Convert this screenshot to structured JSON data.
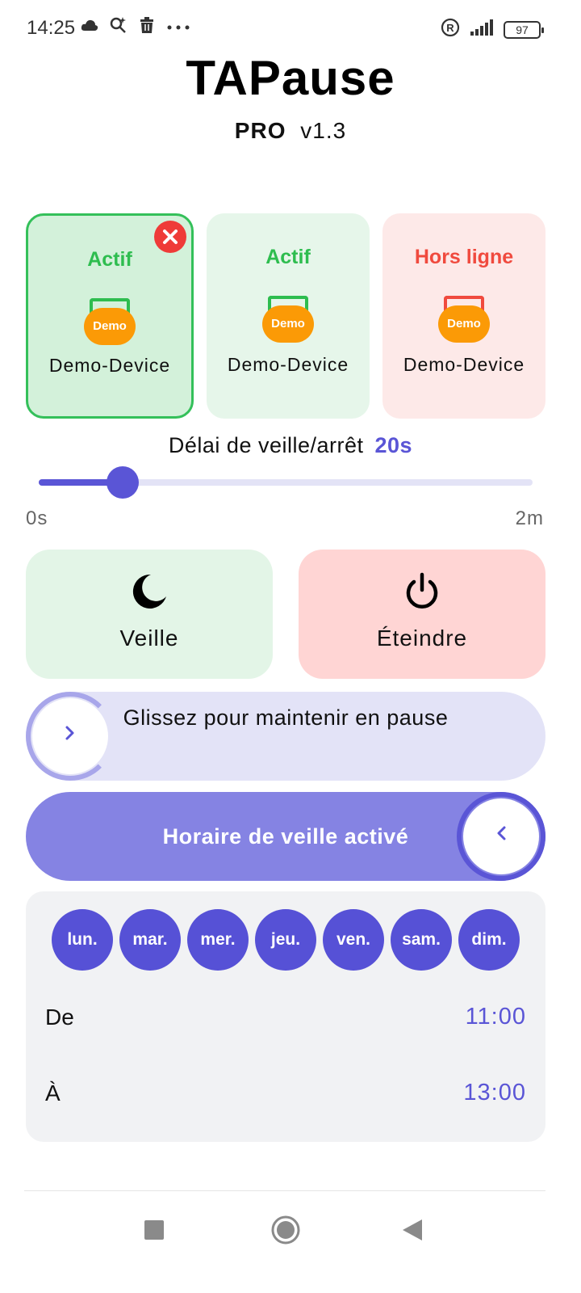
{
  "status_bar": {
    "time": "14:25",
    "battery": "97",
    "left_icons": [
      "cloud-icon",
      "search-sparkle-icon",
      "trash-icon",
      "more-dots-icon"
    ],
    "right_icons": [
      "registered-icon",
      "signal-icon",
      "battery-icon"
    ]
  },
  "app": {
    "title": "TAPause",
    "edition": "PRO",
    "version": "v1.3"
  },
  "devices": [
    {
      "status": "Actif",
      "badge": "Demo",
      "name": "Demo-Device",
      "state": "selected"
    },
    {
      "status": "Actif",
      "badge": "Demo",
      "name": "Demo-Device",
      "state": "online"
    },
    {
      "status": "Hors ligne",
      "badge": "Demo",
      "name": "Demo-Device",
      "state": "offline"
    }
  ],
  "delay": {
    "label": "Délai de veille/arrêt",
    "value": "20s",
    "min_label": "0s",
    "max_label": "2m",
    "level": 0.17
  },
  "actions": {
    "sleep_label": "Veille",
    "off_label": "Éteindre"
  },
  "swipe": {
    "text": "Glissez pour maintenir en pause"
  },
  "schedule": {
    "toggle_text": "Horaire de veille activé",
    "days": [
      "lun.",
      "mar.",
      "mer.",
      "jeu.",
      "ven.",
      "sam.",
      "dim."
    ],
    "from_label": "De",
    "from_value": "11:00",
    "to_label": "À",
    "to_value": "13:00"
  },
  "colors": {
    "accent": "#5a55d6",
    "active_green": "#2ebd4f",
    "offline_red": "#f04a3e",
    "demo_orange": "#fb9a06"
  }
}
